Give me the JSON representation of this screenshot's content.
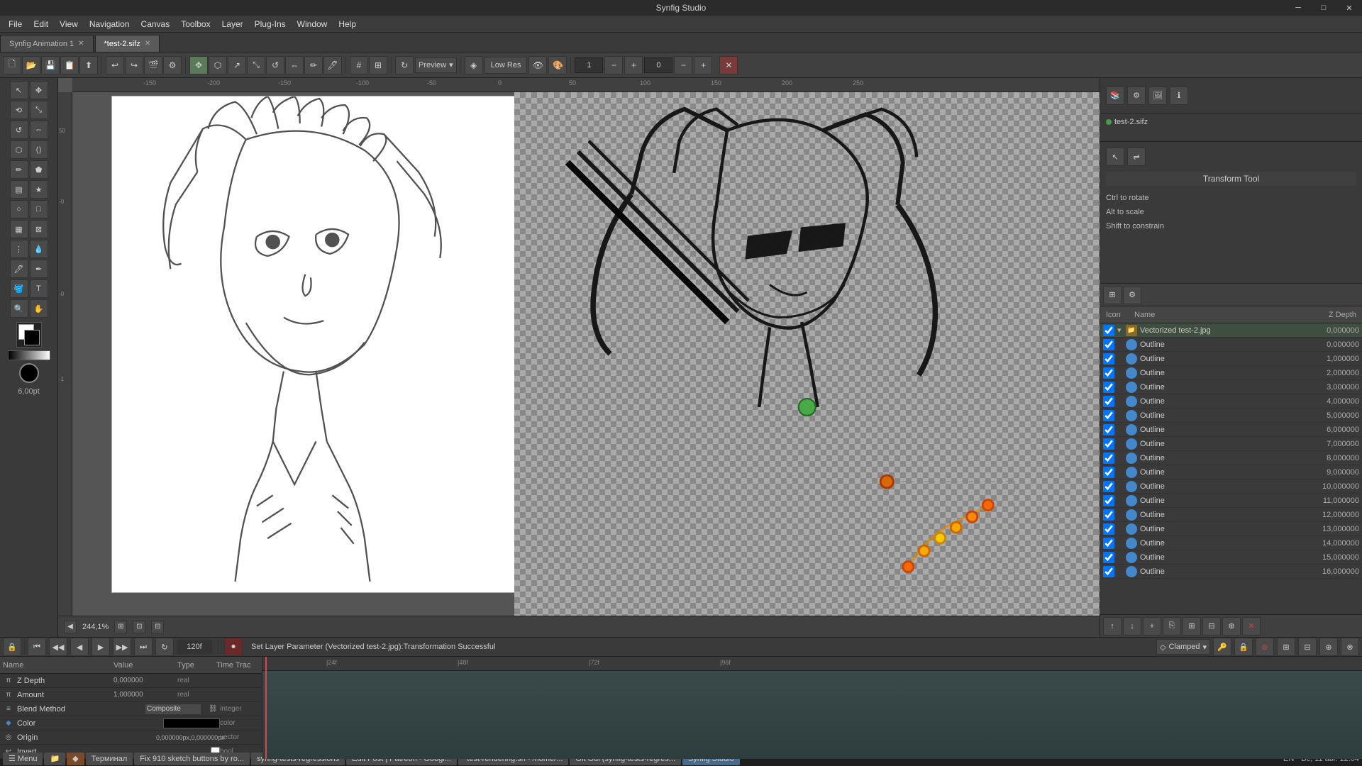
{
  "titlebar": {
    "title": "Synfig Studio",
    "minimize": "─",
    "maximize": "□",
    "close": "✕"
  },
  "menubar": {
    "items": [
      "File",
      "Edit",
      "View",
      "Navigation",
      "Canvas",
      "Toolbox",
      "Layer",
      "Plug-Ins",
      "Window",
      "Help"
    ]
  },
  "tabs": [
    {
      "label": "Synfig Animation 1",
      "active": false
    },
    {
      "label": "*test-2.sifz",
      "active": true
    }
  ],
  "toolbar": {
    "preview_label": "Preview",
    "lowres_label": "Low Res",
    "zoom_value": "1",
    "frame_value": "0",
    "zoom_percent": "244,1%",
    "frame_total": "120f",
    "current_frame": "0f"
  },
  "transform_tool": {
    "title": "Transform Tool",
    "hint1": "Ctrl to rotate",
    "hint2": "Alt to scale",
    "hint3": "Shift to constrain"
  },
  "layers": {
    "columns": {
      "icon": "Icon",
      "name": "Name",
      "zdepth": "Z Depth"
    },
    "items": [
      {
        "name": "Vectorized test-2.jpg",
        "zdepth": "0,000000",
        "type": "folder",
        "checked": true,
        "indent": 0
      },
      {
        "name": "Outline",
        "zdepth": "0,000000",
        "type": "layer",
        "checked": true,
        "indent": 1
      },
      {
        "name": "Outline",
        "zdepth": "1,000000",
        "type": "layer",
        "checked": true,
        "indent": 1
      },
      {
        "name": "Outline",
        "zdepth": "2,000000",
        "type": "layer",
        "checked": true,
        "indent": 1
      },
      {
        "name": "Outline",
        "zdepth": "3,000000",
        "type": "layer",
        "checked": true,
        "indent": 1
      },
      {
        "name": "Outline",
        "zdepth": "4,000000",
        "type": "layer",
        "checked": true,
        "indent": 1
      },
      {
        "name": "Outline",
        "zdepth": "5,000000",
        "type": "layer",
        "checked": true,
        "indent": 1
      },
      {
        "name": "Outline",
        "zdepth": "6,000000",
        "type": "layer",
        "checked": true,
        "indent": 1
      },
      {
        "name": "Outline",
        "zdepth": "7,000000",
        "type": "layer",
        "checked": true,
        "indent": 1
      },
      {
        "name": "Outline",
        "zdepth": "8,000000",
        "type": "layer",
        "checked": true,
        "indent": 1
      },
      {
        "name": "Outline",
        "zdepth": "9,000000",
        "type": "layer",
        "checked": true,
        "indent": 1
      },
      {
        "name": "Outline",
        "zdepth": "10,000000",
        "type": "layer",
        "checked": true,
        "indent": 1
      },
      {
        "name": "Outline",
        "zdepth": "11,000000",
        "type": "layer",
        "checked": true,
        "indent": 1
      },
      {
        "name": "Outline",
        "zdepth": "12,000000",
        "type": "layer",
        "checked": true,
        "indent": 1
      },
      {
        "name": "Outline",
        "zdepth": "13,000000",
        "type": "layer",
        "checked": true,
        "indent": 1
      },
      {
        "name": "Outline",
        "zdepth": "14,000000",
        "type": "layer",
        "checked": true,
        "indent": 1
      },
      {
        "name": "Outline",
        "zdepth": "15,000000",
        "type": "layer",
        "checked": true,
        "indent": 1
      },
      {
        "name": "Outline",
        "zdepth": "16,000000",
        "type": "layer",
        "checked": true,
        "indent": 1
      }
    ]
  },
  "timeline": {
    "status_message": "Set Layer Parameter (Vectorized test-2.jpg):Transformation Successful",
    "clamp_label": "Clamped",
    "time_markers": [
      "24f",
      "48f",
      "72f",
      "96f"
    ],
    "params_header": {
      "name": "Name",
      "value": "Value",
      "type": "Type",
      "timetrac": "Time Trac"
    }
  },
  "params": {
    "items": [
      {
        "name": "Z Depth",
        "value": "0,000000",
        "type": "real",
        "icon": "π"
      },
      {
        "name": "Amount",
        "value": "1,000000",
        "type": "real",
        "icon": "π"
      },
      {
        "name": "Blend Method",
        "value": "Composite",
        "type": "integer",
        "icon": "≡"
      },
      {
        "name": "Color",
        "value": "",
        "type": "color",
        "icon": "◆"
      },
      {
        "name": "Origin",
        "value": "0,000000px,0,000000px",
        "type": "vector",
        "icon": "◎"
      },
      {
        "name": "Invert",
        "value": "",
        "type": "bool",
        "icon": "↩"
      }
    ]
  },
  "statusbar": {
    "taskbar": [
      {
        "label": "Menu",
        "icon": "☰"
      },
      {
        "label": "Files",
        "icon": "📁"
      },
      {
        "label": "◆"
      },
      {
        "label": "Терминал"
      },
      {
        "label": "Fix 910 sketch buttons by ro..."
      },
      {
        "label": "synfig-tests-regressions"
      },
      {
        "label": "Edit Post | Patreon - Googl..."
      },
      {
        "label": "*test-rendering.sh - /home/..."
      },
      {
        "label": "Git Gui (synfig-tests-regres..."
      },
      {
        "label": "Synfig Studio"
      }
    ],
    "time": "Вс, 11 авг. 12:04",
    "locale": "EN"
  },
  "filetree": {
    "items": [
      {
        "label": "test-2.sifz",
        "icon": "file"
      }
    ]
  }
}
